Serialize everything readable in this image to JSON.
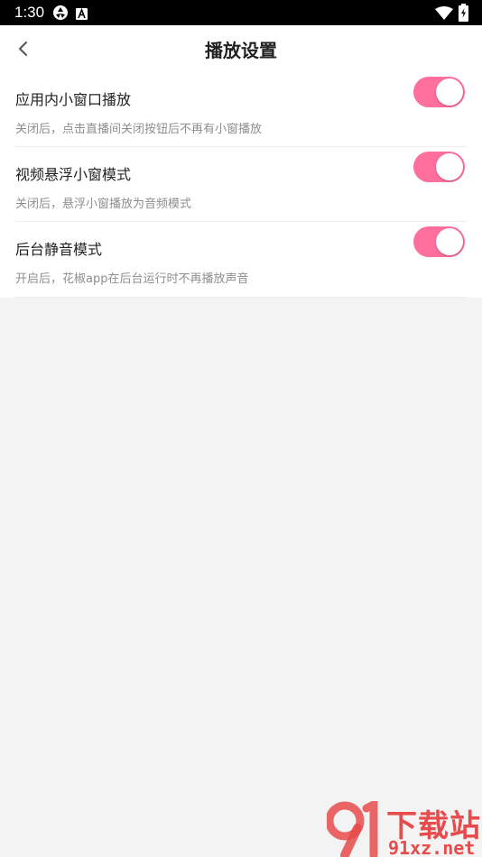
{
  "status_bar": {
    "time": "1:30"
  },
  "header": {
    "title": "播放设置"
  },
  "settings": [
    {
      "title": "应用内小窗口播放",
      "desc": "关闭后，点击直播间关闭按钮后不再有小窗播放",
      "enabled": true
    },
    {
      "title": "视频悬浮小窗模式",
      "desc": "关闭后，悬浮小窗播放为音频模式",
      "enabled": true
    },
    {
      "title": "后台静音模式",
      "desc": "开启后，花椒app在后台运行时不再播放声音",
      "enabled": true
    }
  ],
  "watermark": {
    "cn": "下载站",
    "url": "91xz.net"
  },
  "colors": {
    "accent": "#ff6f9c",
    "watermark": "#e74b4b"
  }
}
